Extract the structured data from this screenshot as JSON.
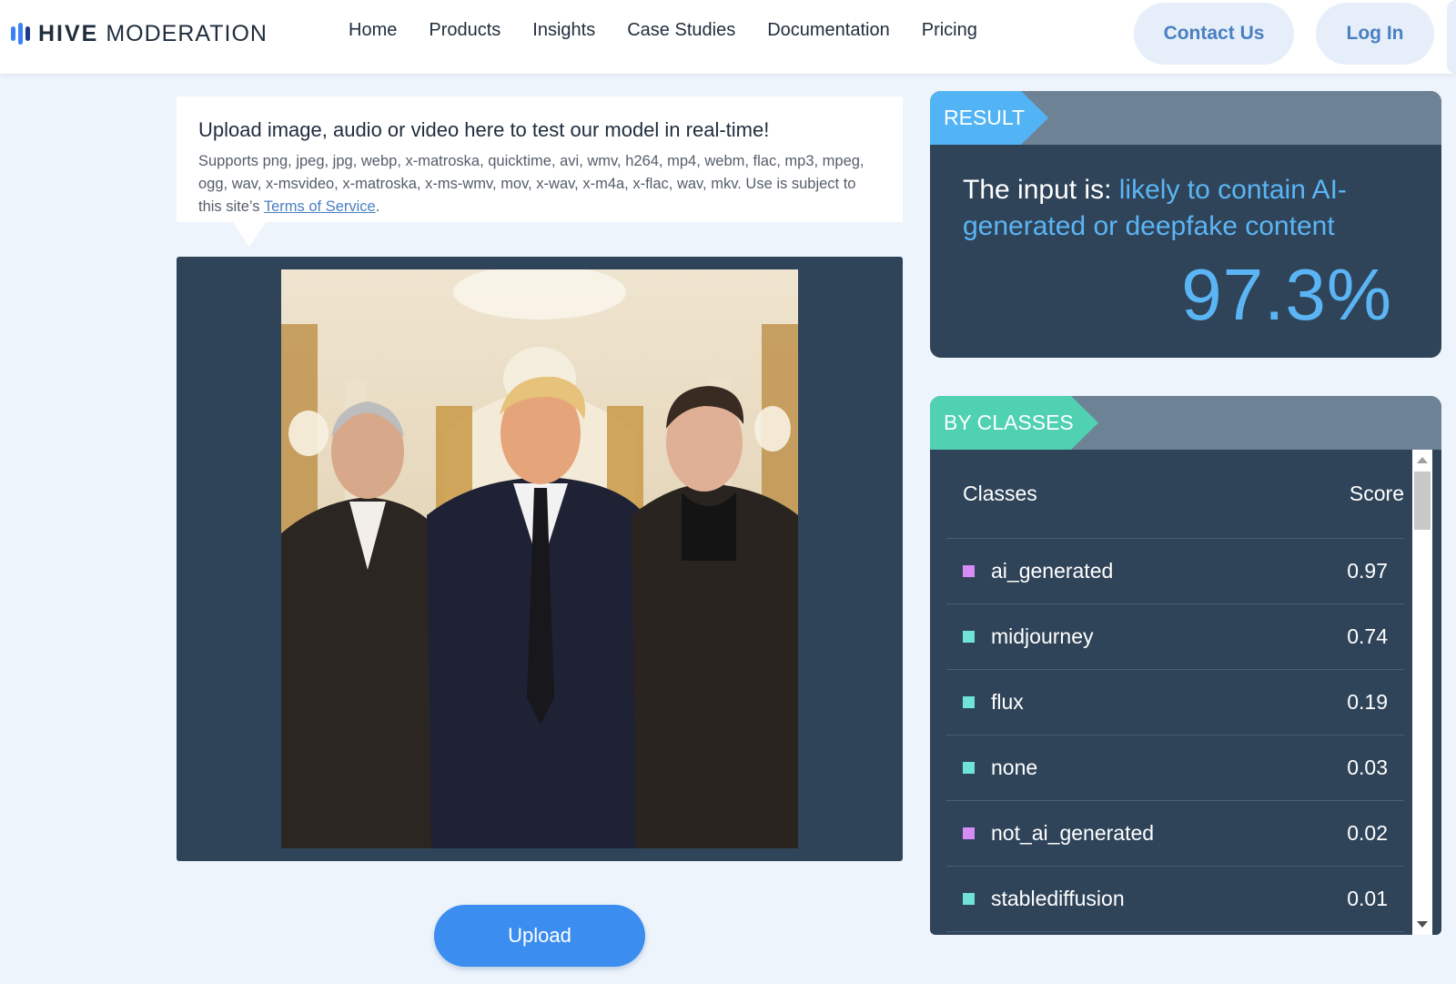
{
  "brand": {
    "name_bold": "HIVE",
    "name_light": "MODERATION",
    "logo_icon": "sound-bars-icon",
    "accent": "#3b82f6"
  },
  "nav": {
    "links": [
      "Home",
      "Products",
      "Insights",
      "Case Studies",
      "Documentation",
      "Pricing"
    ],
    "contact_label": "Contact Us",
    "login_label": "Log In"
  },
  "upload_info": {
    "title": "Upload image, audio or video here to test our model in real-time!",
    "formats_text": "Supports png, jpeg, jpg, webp, x-matroska, quicktime, avi, wmv, h264, mp4, webm, flac, mp3, mpeg, ogg, wav, x-msvideo, x-matroska, x-ms-wmv, mov, x-wav, x-m4a, x-flac, wav, mkv. Use is subject to this site’s ",
    "terms_link": "Terms of Service",
    "terms_suffix": "."
  },
  "upload_button_label": "Upload",
  "result": {
    "tab_label": "RESULT",
    "prefix": "The input is: ",
    "verdict": "likely to contain AI-generated or deepfake content",
    "score": "97.3%",
    "tab_color": "#53b4f5",
    "verdict_color": "#5bb5f5"
  },
  "by_classes": {
    "tab_label": "BY CLASSES",
    "tab_color": "#4fd1b2",
    "header_classes": "Classes",
    "header_score": "Score",
    "rows": [
      {
        "name": "ai_generated",
        "score": "0.97",
        "color": "#d58cf5"
      },
      {
        "name": "midjourney",
        "score": "0.74",
        "color": "#6fe3d6"
      },
      {
        "name": "flux",
        "score": "0.19",
        "color": "#6fe3d6"
      },
      {
        "name": "none",
        "score": "0.03",
        "color": "#6fe3d6"
      },
      {
        "name": "not_ai_generated",
        "score": "0.02",
        "color": "#d58cf5"
      },
      {
        "name": "stablediffusion",
        "score": "0.01",
        "color": "#6fe3d6"
      }
    ]
  }
}
